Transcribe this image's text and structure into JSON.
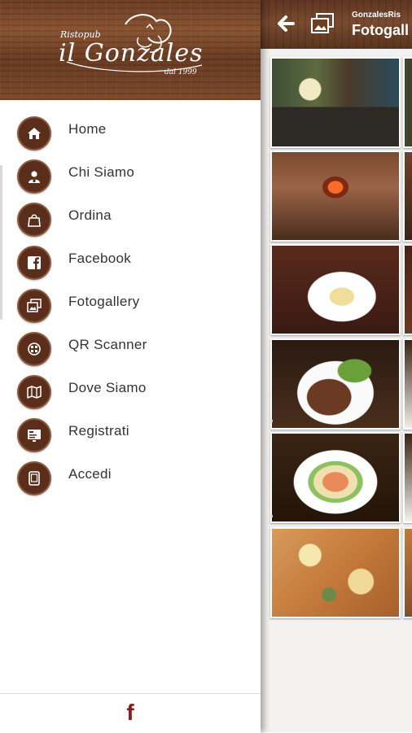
{
  "app": {
    "subtitle": "GonzalesRis",
    "title": "Fotogall"
  },
  "drawer": {
    "logo": {
      "top_text": "Ristopub",
      "main_text": "il Gonzales",
      "sub_text": "dal 1999"
    },
    "items": [
      {
        "label": "Home",
        "icon": "home-icon"
      },
      {
        "label": "Chi Siamo",
        "icon": "user-badge-icon"
      },
      {
        "label": "Ordina",
        "icon": "shopping-bag-icon"
      },
      {
        "label": "Facebook",
        "icon": "facebook-icon"
      },
      {
        "label": "Fotogallery",
        "icon": "gallery-icon"
      },
      {
        "label": "QR Scanner",
        "icon": "qr-scanner-icon"
      },
      {
        "label": "Dove Siamo",
        "icon": "map-icon"
      },
      {
        "label": "Registrati",
        "icon": "register-icon"
      },
      {
        "label": "Accedi",
        "icon": "login-icon"
      }
    ],
    "footer_icon": "f"
  },
  "colors": {
    "wood": "#7a4a2f",
    "icon_bg": "#5a2e1a",
    "accent_red": "#8b1a1a"
  }
}
